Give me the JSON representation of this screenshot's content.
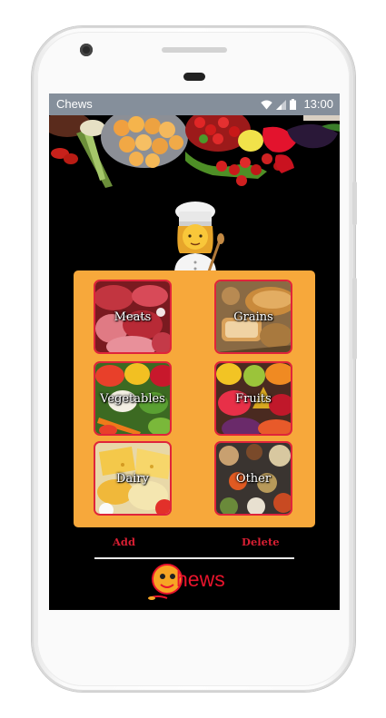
{
  "status_bar": {
    "app_title": "Chews",
    "time": "13:00",
    "icons": [
      "wifi-icon",
      "signal-icon",
      "battery-icon"
    ]
  },
  "header": {
    "banner": "food-banner-image",
    "mascot": "chef-emoji-icon"
  },
  "categories": [
    {
      "label": "Meats"
    },
    {
      "label": "Grains"
    },
    {
      "label": "Vegetables"
    },
    {
      "label": "Fruits"
    },
    {
      "label": "Dairy"
    },
    {
      "label": "Other"
    }
  ],
  "actions": {
    "add_label": "Add",
    "delete_label": "Delete"
  },
  "logo": {
    "text": "hews"
  },
  "colors": {
    "panel": "#f7a83b",
    "tile_border": "#e0243a",
    "action_text": "#d81f33",
    "status_bar": "#858f9b",
    "logo_red": "#e8142c"
  }
}
